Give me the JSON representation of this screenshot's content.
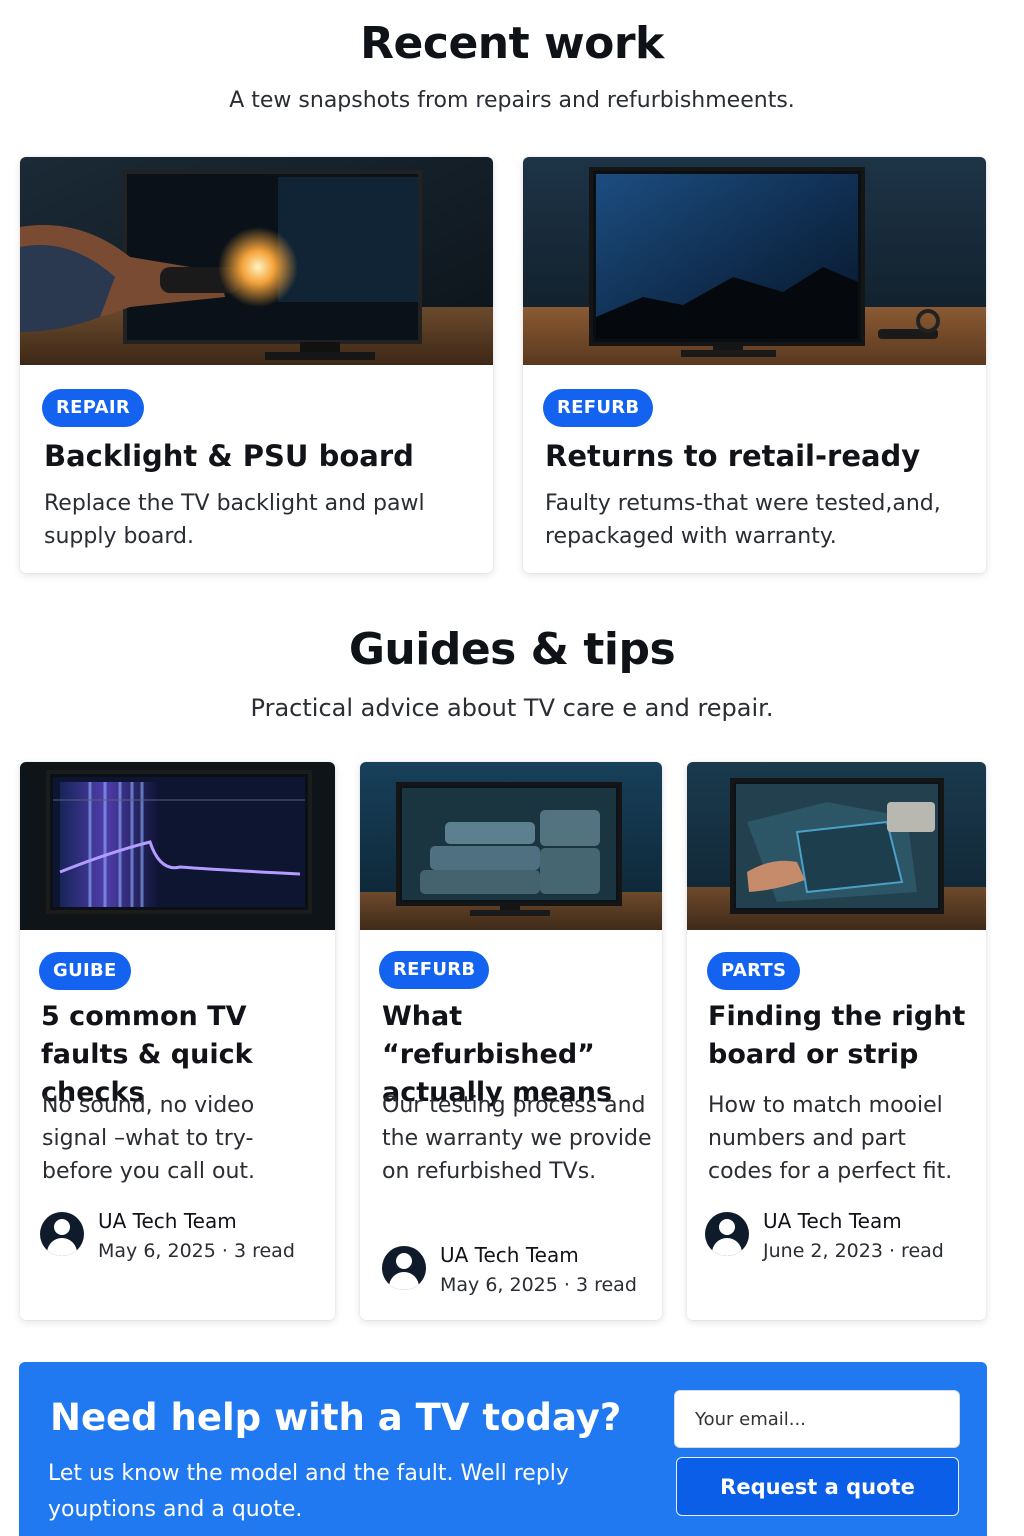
{
  "recent_work": {
    "title": "Recent work",
    "subtitle": "A tew snapshots from repairs and refurbishmeents.",
    "cards": [
      {
        "badge": "REPAIR",
        "title": "Backlight & PSU board",
        "description": "Replace the TV backlight and pawl supply board."
      },
      {
        "badge": "REFURB",
        "title": "Returns to retail-ready",
        "description": "Faulty retums-that were tested,and, repackaged with warranty."
      }
    ]
  },
  "guides": {
    "title": "Guides & tips",
    "subtitle": "Practical advice about TV care e and repair.",
    "cards": [
      {
        "badge": "GUIBE",
        "title": "5 common TV faults & quick checks",
        "description": "No sound, no video signal –what to try-before you call out.",
        "author": "UA Tech Team",
        "meta": "May 6, 2025 · 3 read"
      },
      {
        "badge": "REFURB",
        "title": "What “refurbished” actually means",
        "description": "Our testing process and the warranty we provide on refurbished TVs.",
        "author": "UA Tech Team",
        "meta": "May 6, 2025 · 3 read"
      },
      {
        "badge": "PARTS",
        "title": "Finding the right board or strip",
        "description": "How to match mooiel numbers and part codes for a perfect fit.",
        "author": "UA Tech Team",
        "meta": "June 2, 2023 · read"
      }
    ]
  },
  "cta": {
    "title": "Need help with a TV today?",
    "description": "Let us know the model and the fault. Well reply youptions and a quote.",
    "email_placeholder": "Your email...",
    "button_label": "Request a quote"
  },
  "colors": {
    "accent": "#1463f0",
    "cta_background": "#2079f0",
    "text": "#111318"
  },
  "icons": [
    "user-avatar-icon"
  ]
}
